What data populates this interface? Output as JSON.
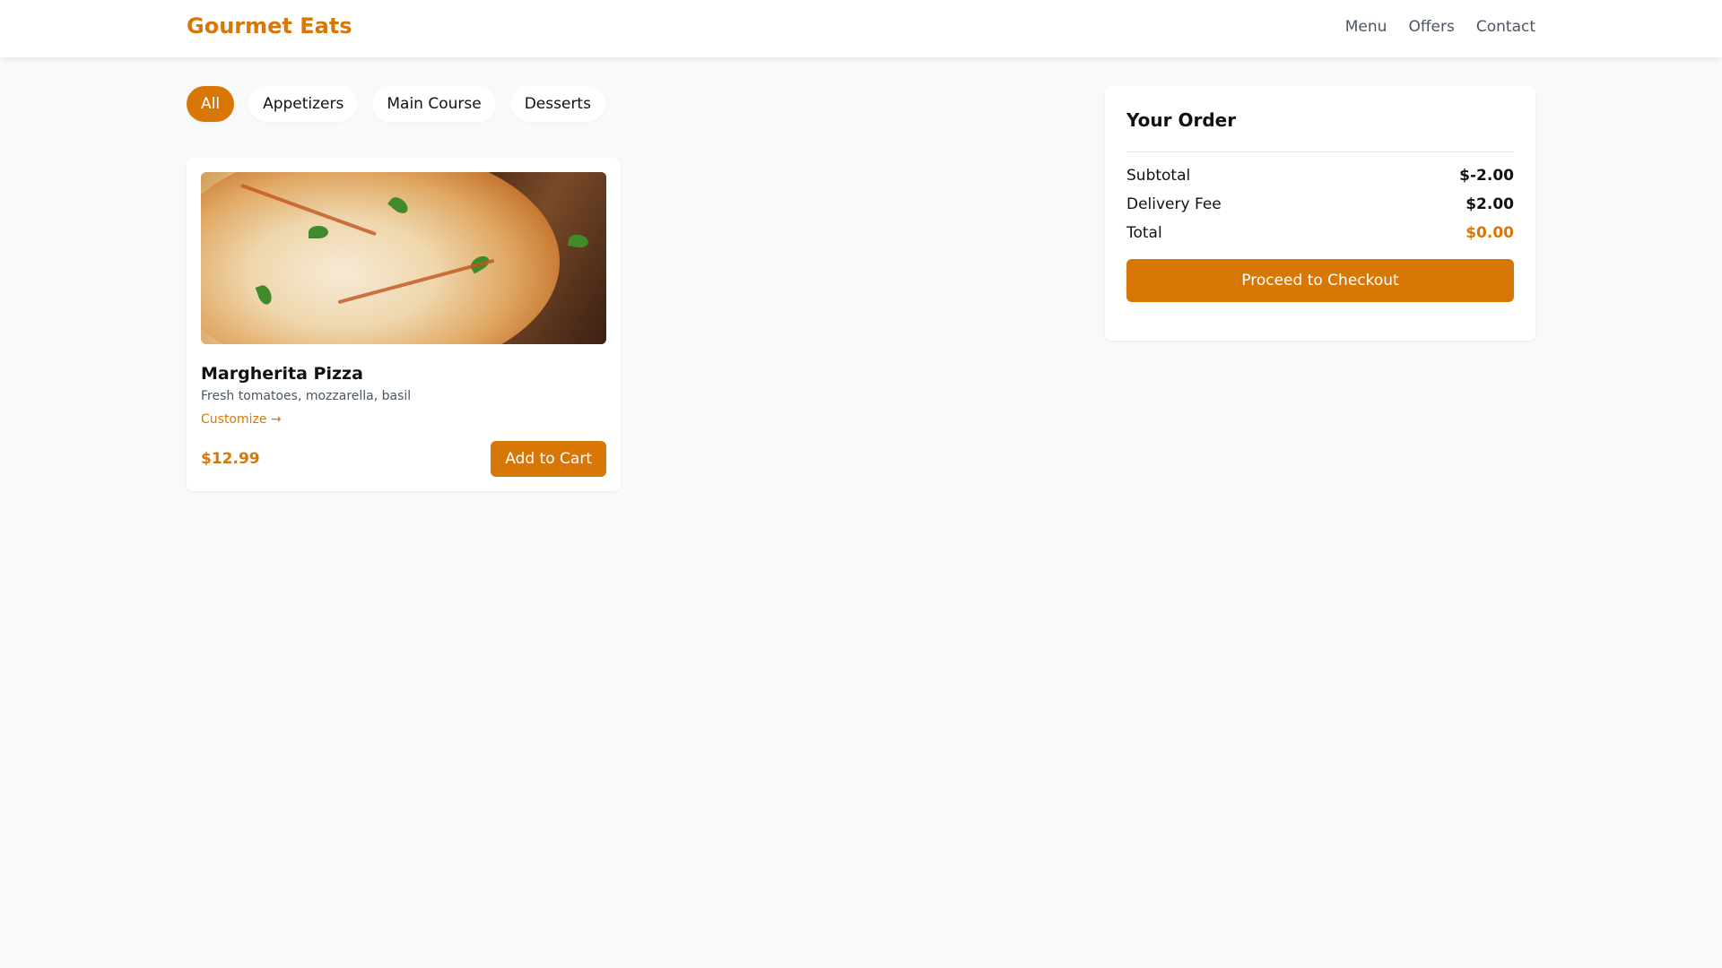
{
  "header": {
    "brand": "Gourmet Eats",
    "nav": [
      "Menu",
      "Offers",
      "Contact"
    ]
  },
  "filters": {
    "items": [
      "All",
      "Appetizers",
      "Main Course",
      "Desserts"
    ],
    "active": "All"
  },
  "menu_items": [
    {
      "name": "Margherita Pizza",
      "description": "Fresh tomatoes, mozzarella, basil",
      "customize_label": "Customize →",
      "price": "$12.99",
      "add_label": "Add to Cart",
      "image_icon": "pizza-photo"
    }
  ],
  "order": {
    "title": "Your Order",
    "subtotal_label": "Subtotal",
    "subtotal_value": "$-2.00",
    "delivery_label": "Delivery Fee",
    "delivery_value": "$2.00",
    "total_label": "Total",
    "total_value": "$0.00",
    "checkout_label": "Proceed to Checkout"
  },
  "colors": {
    "accent": "#d97706",
    "background": "#f8f9fb"
  }
}
